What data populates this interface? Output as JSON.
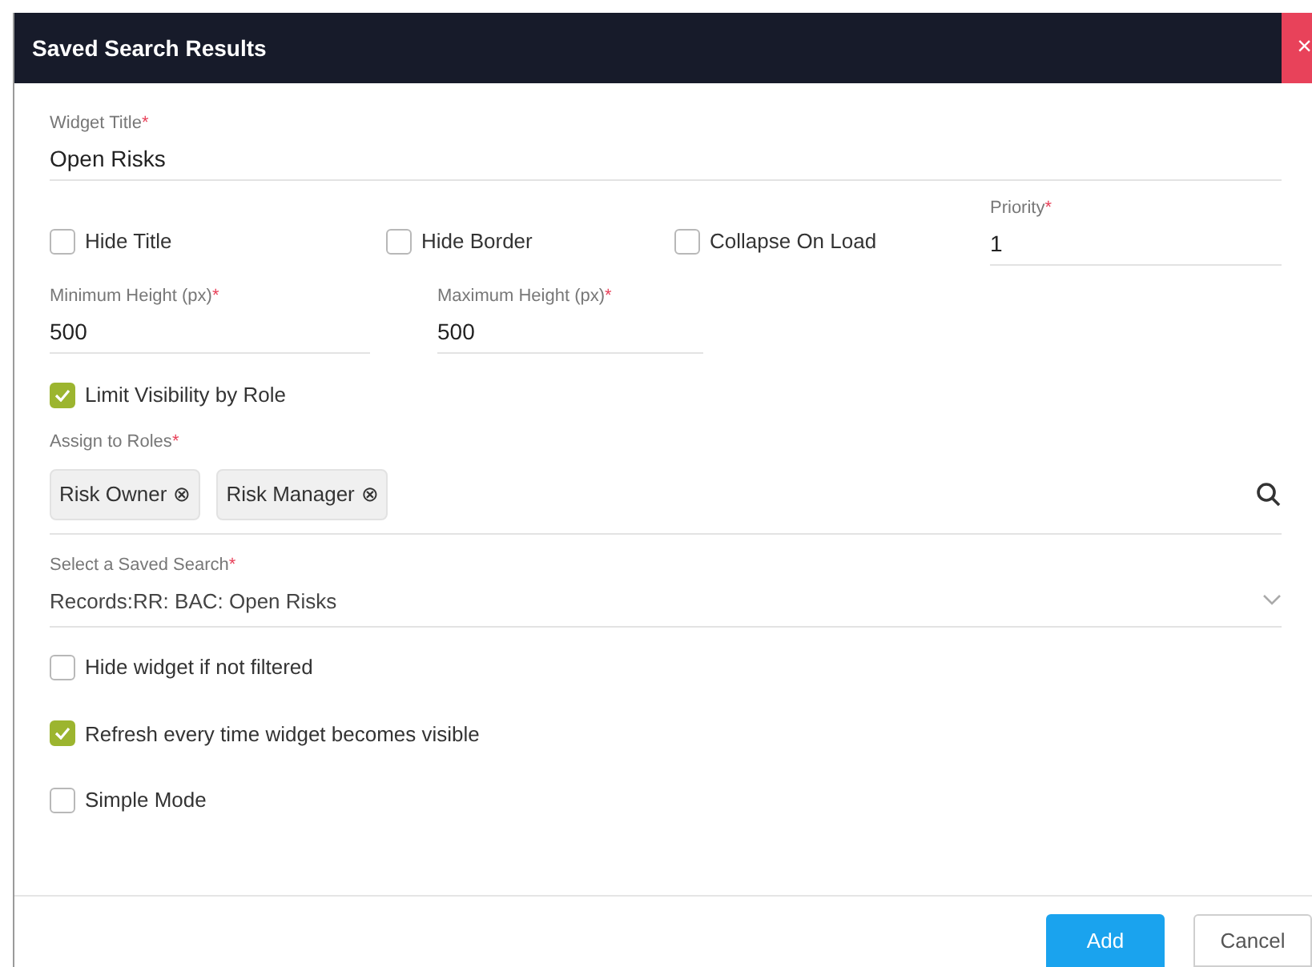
{
  "window": {
    "title": "Saved Search Results",
    "close": "×"
  },
  "widget_title": {
    "label": "Widget Title",
    "required_mark": "*",
    "value": "Open Risks"
  },
  "options_row": [
    {
      "label": "Hide Title",
      "checked": false
    },
    {
      "label": "Hide Border",
      "checked": false
    },
    {
      "label": "Collapse On Load",
      "checked": false
    }
  ],
  "priority": {
    "label": "Priority",
    "required_mark": "*",
    "value": "1"
  },
  "min_height": {
    "label": "Minimum Height (px)",
    "required_mark": "*",
    "value": "500"
  },
  "max_height": {
    "label": "Maximum Height (px)",
    "required_mark": "*",
    "value": "500"
  },
  "limit_visibility": {
    "label": "Limit Visibility by Role",
    "checked": true
  },
  "roles": {
    "label": "Assign to Roles",
    "required_mark": "*",
    "tags": [
      {
        "label": "Risk Owner",
        "remove": "⊗"
      },
      {
        "label": "Risk Manager",
        "remove": "⊗"
      }
    ]
  },
  "saved_search": {
    "label": "Select a Saved Search",
    "required_mark": "*",
    "value": "Records:RR: BAC: Open Risks"
  },
  "options": [
    {
      "label": "Hide widget if not filtered",
      "checked": false
    },
    {
      "label": "Refresh every time widget becomes visible",
      "checked": true
    },
    {
      "label": "Simple Mode",
      "checked": false
    }
  ],
  "buttons": [
    {
      "label": "Add",
      "kind": "primary"
    },
    {
      "label": "Cancel",
      "kind": "secondary"
    }
  ]
}
